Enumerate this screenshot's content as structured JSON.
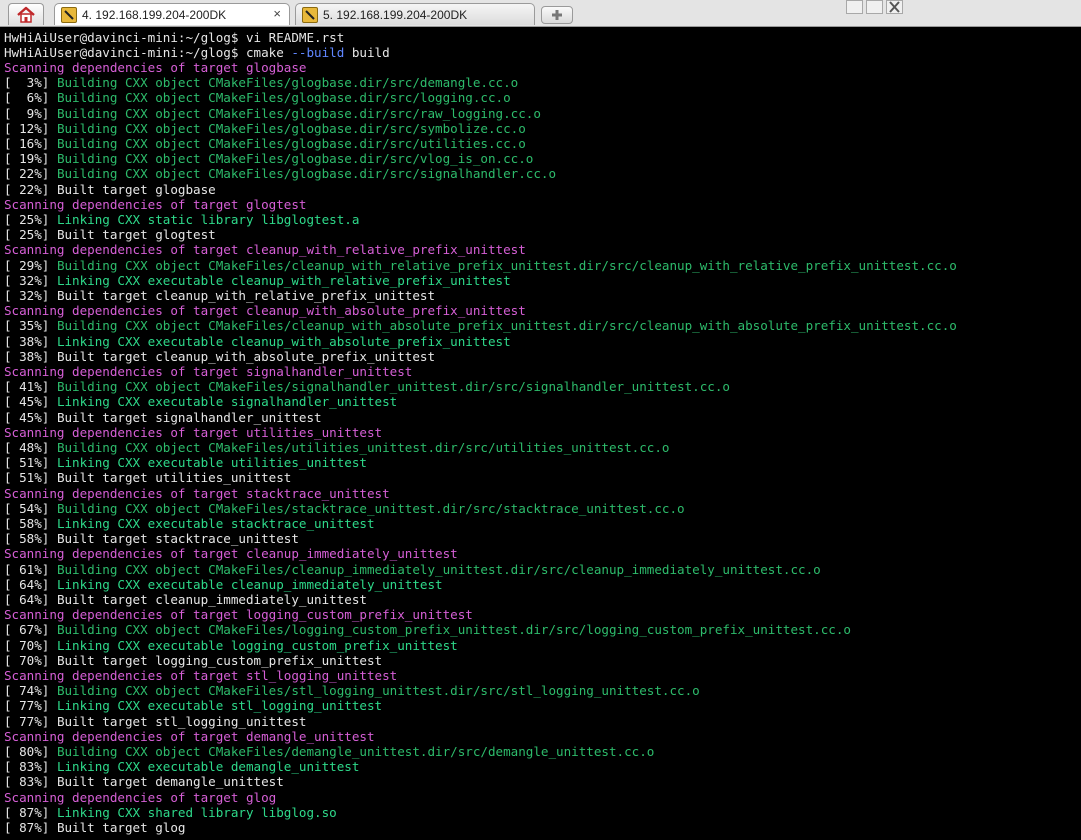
{
  "tabs": [
    {
      "label": "4. 192.168.199.204-200DK",
      "close": "×",
      "active": true
    },
    {
      "label": "5. 192.168.199.204-200DK",
      "active": false
    }
  ],
  "prompt": {
    "user_host": "HwHiAiUser@davinci-mini:~/glog$",
    "cmd1": " vi README.rst",
    "cmd2_a": " cmake ",
    "cmd2_flag": "--build",
    "cmd2_b": " build"
  },
  "lines": [
    {
      "color": "magenta",
      "text": "Scanning dependencies of target glogbase"
    },
    {
      "color": "green",
      "prefix": "[  3%] ",
      "text": "Building CXX object CMakeFiles/glogbase.dir/src/demangle.cc.o"
    },
    {
      "color": "green",
      "prefix": "[  6%] ",
      "text": "Building CXX object CMakeFiles/glogbase.dir/src/logging.cc.o"
    },
    {
      "color": "green",
      "prefix": "[  9%] ",
      "text": "Building CXX object CMakeFiles/glogbase.dir/src/raw_logging.cc.o"
    },
    {
      "color": "green",
      "prefix": "[ 12%] ",
      "text": "Building CXX object CMakeFiles/glogbase.dir/src/symbolize.cc.o"
    },
    {
      "color": "green",
      "prefix": "[ 16%] ",
      "text": "Building CXX object CMakeFiles/glogbase.dir/src/utilities.cc.o"
    },
    {
      "color": "green",
      "prefix": "[ 19%] ",
      "text": "Building CXX object CMakeFiles/glogbase.dir/src/vlog_is_on.cc.o"
    },
    {
      "color": "green",
      "prefix": "[ 22%] ",
      "text": "Building CXX object CMakeFiles/glogbase.dir/src/signalhandler.cc.o"
    },
    {
      "color": "white",
      "prefix": "[ 22%] ",
      "text": "Built target glogbase"
    },
    {
      "color": "magenta",
      "text": "Scanning dependencies of target glogtest"
    },
    {
      "color": "bgreen",
      "prefix": "[ 25%] ",
      "text": "Linking CXX static library libglogtest.a"
    },
    {
      "color": "white",
      "prefix": "[ 25%] ",
      "text": "Built target glogtest"
    },
    {
      "color": "magenta",
      "text": "Scanning dependencies of target cleanup_with_relative_prefix_unittest"
    },
    {
      "color": "green",
      "prefix": "[ 29%] ",
      "text": "Building CXX object CMakeFiles/cleanup_with_relative_prefix_unittest.dir/src/cleanup_with_relative_prefix_unittest.cc.o"
    },
    {
      "color": "bgreen",
      "prefix": "[ 32%] ",
      "text": "Linking CXX executable cleanup_with_relative_prefix_unittest"
    },
    {
      "color": "white",
      "prefix": "[ 32%] ",
      "text": "Built target cleanup_with_relative_prefix_unittest"
    },
    {
      "color": "magenta",
      "text": "Scanning dependencies of target cleanup_with_absolute_prefix_unittest"
    },
    {
      "color": "green",
      "prefix": "[ 35%] ",
      "text": "Building CXX object CMakeFiles/cleanup_with_absolute_prefix_unittest.dir/src/cleanup_with_absolute_prefix_unittest.cc.o"
    },
    {
      "color": "bgreen",
      "prefix": "[ 38%] ",
      "text": "Linking CXX executable cleanup_with_absolute_prefix_unittest"
    },
    {
      "color": "white",
      "prefix": "[ 38%] ",
      "text": "Built target cleanup_with_absolute_prefix_unittest"
    },
    {
      "color": "magenta",
      "text": "Scanning dependencies of target signalhandler_unittest"
    },
    {
      "color": "green",
      "prefix": "[ 41%] ",
      "text": "Building CXX object CMakeFiles/signalhandler_unittest.dir/src/signalhandler_unittest.cc.o"
    },
    {
      "color": "bgreen",
      "prefix": "[ 45%] ",
      "text": "Linking CXX executable signalhandler_unittest"
    },
    {
      "color": "white",
      "prefix": "[ 45%] ",
      "text": "Built target signalhandler_unittest"
    },
    {
      "color": "magenta",
      "text": "Scanning dependencies of target utilities_unittest"
    },
    {
      "color": "green",
      "prefix": "[ 48%] ",
      "text": "Building CXX object CMakeFiles/utilities_unittest.dir/src/utilities_unittest.cc.o"
    },
    {
      "color": "bgreen",
      "prefix": "[ 51%] ",
      "text": "Linking CXX executable utilities_unittest"
    },
    {
      "color": "white",
      "prefix": "[ 51%] ",
      "text": "Built target utilities_unittest"
    },
    {
      "color": "magenta",
      "text": "Scanning dependencies of target stacktrace_unittest"
    },
    {
      "color": "green",
      "prefix": "[ 54%] ",
      "text": "Building CXX object CMakeFiles/stacktrace_unittest.dir/src/stacktrace_unittest.cc.o"
    },
    {
      "color": "bgreen",
      "prefix": "[ 58%] ",
      "text": "Linking CXX executable stacktrace_unittest"
    },
    {
      "color": "white",
      "prefix": "[ 58%] ",
      "text": "Built target stacktrace_unittest"
    },
    {
      "color": "magenta",
      "text": "Scanning dependencies of target cleanup_immediately_unittest"
    },
    {
      "color": "green",
      "prefix": "[ 61%] ",
      "text": "Building CXX object CMakeFiles/cleanup_immediately_unittest.dir/src/cleanup_immediately_unittest.cc.o"
    },
    {
      "color": "bgreen",
      "prefix": "[ 64%] ",
      "text": "Linking CXX executable cleanup_immediately_unittest"
    },
    {
      "color": "white",
      "prefix": "[ 64%] ",
      "text": "Built target cleanup_immediately_unittest"
    },
    {
      "color": "magenta",
      "text": "Scanning dependencies of target logging_custom_prefix_unittest"
    },
    {
      "color": "green",
      "prefix": "[ 67%] ",
      "text": "Building CXX object CMakeFiles/logging_custom_prefix_unittest.dir/src/logging_custom_prefix_unittest.cc.o"
    },
    {
      "color": "bgreen",
      "prefix": "[ 70%] ",
      "text": "Linking CXX executable logging_custom_prefix_unittest"
    },
    {
      "color": "white",
      "prefix": "[ 70%] ",
      "text": "Built target logging_custom_prefix_unittest"
    },
    {
      "color": "magenta",
      "text": "Scanning dependencies of target stl_logging_unittest"
    },
    {
      "color": "green",
      "prefix": "[ 74%] ",
      "text": "Building CXX object CMakeFiles/stl_logging_unittest.dir/src/stl_logging_unittest.cc.o"
    },
    {
      "color": "bgreen",
      "prefix": "[ 77%] ",
      "text": "Linking CXX executable stl_logging_unittest"
    },
    {
      "color": "white",
      "prefix": "[ 77%] ",
      "text": "Built target stl_logging_unittest"
    },
    {
      "color": "magenta",
      "text": "Scanning dependencies of target demangle_unittest"
    },
    {
      "color": "green",
      "prefix": "[ 80%] ",
      "text": "Building CXX object CMakeFiles/demangle_unittest.dir/src/demangle_unittest.cc.o"
    },
    {
      "color": "bgreen",
      "prefix": "[ 83%] ",
      "text": "Linking CXX executable demangle_unittest"
    },
    {
      "color": "white",
      "prefix": "[ 83%] ",
      "text": "Built target demangle_unittest"
    },
    {
      "color": "magenta",
      "text": "Scanning dependencies of target glog"
    },
    {
      "color": "bgreen",
      "prefix": "[ 87%] ",
      "text": "Linking CXX shared library libglog.so"
    },
    {
      "color": "white",
      "prefix": "[ 87%] ",
      "text": "Built target glog"
    }
  ],
  "icons": {
    "home": "home-icon",
    "terminal": "terminal-icon",
    "new_tab": "new-tab-icon"
  }
}
